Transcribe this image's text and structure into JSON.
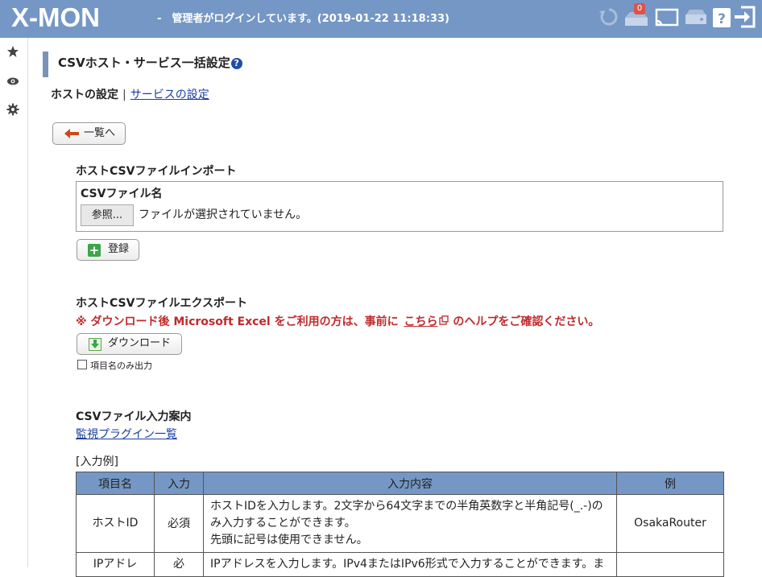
{
  "header": {
    "logo": "X-MON",
    "login_message": "-　管理者がログインしています。(2019-01-22 11:18:33)",
    "notification_count": "0",
    "accent_color": "#7497c5"
  },
  "sidebar": {
    "icons": [
      "star-icon",
      "eye-icon",
      "gear-icon"
    ]
  },
  "page": {
    "title": "CSVホスト・サービス一括設定",
    "help_icon": "?",
    "subnav": {
      "current": "ホストの設定",
      "separator": "|",
      "link": "サービスの設定"
    },
    "back_button": "一覧へ",
    "import": {
      "title": "ホストCSVファイルインポート",
      "field_label": "CSVファイル名",
      "browse_button": "参照...",
      "no_file_text": "ファイルが選択されていません。",
      "register_button": "登録"
    },
    "export": {
      "title": "ホストCSVファイルエクスポート",
      "warning_pre": "※ ダウンロード後 Microsoft Excel をご利用の方は、事前に",
      "warning_link": "こちら",
      "warning_post": "のヘルプをご確認ください。",
      "download_button": "ダウンロード",
      "checkbox_label": "項目名のみ出力"
    },
    "guide": {
      "title": "CSVファイル入力案内",
      "plugin_link": "監視プラグイン一覧",
      "example_label": "[入力例]",
      "columns": [
        "項目名",
        "入力",
        "入力内容",
        "例"
      ],
      "rows": [
        {
          "name": "ホストID",
          "required": "必須",
          "content_lines": [
            "ホストIDを入力します。2文字から64文字までの半角英数字と半角記号(_.-)のみ入力することができます。",
            "先頭に記号は使用できません。"
          ],
          "example": "OsakaRouter"
        },
        {
          "name": "IPアドレ",
          "required": "必",
          "content_lines": [
            "IPアドレスを入力します。IPv4またはIPv6形式で入力することができます。ま"
          ],
          "example": ""
        }
      ]
    }
  }
}
